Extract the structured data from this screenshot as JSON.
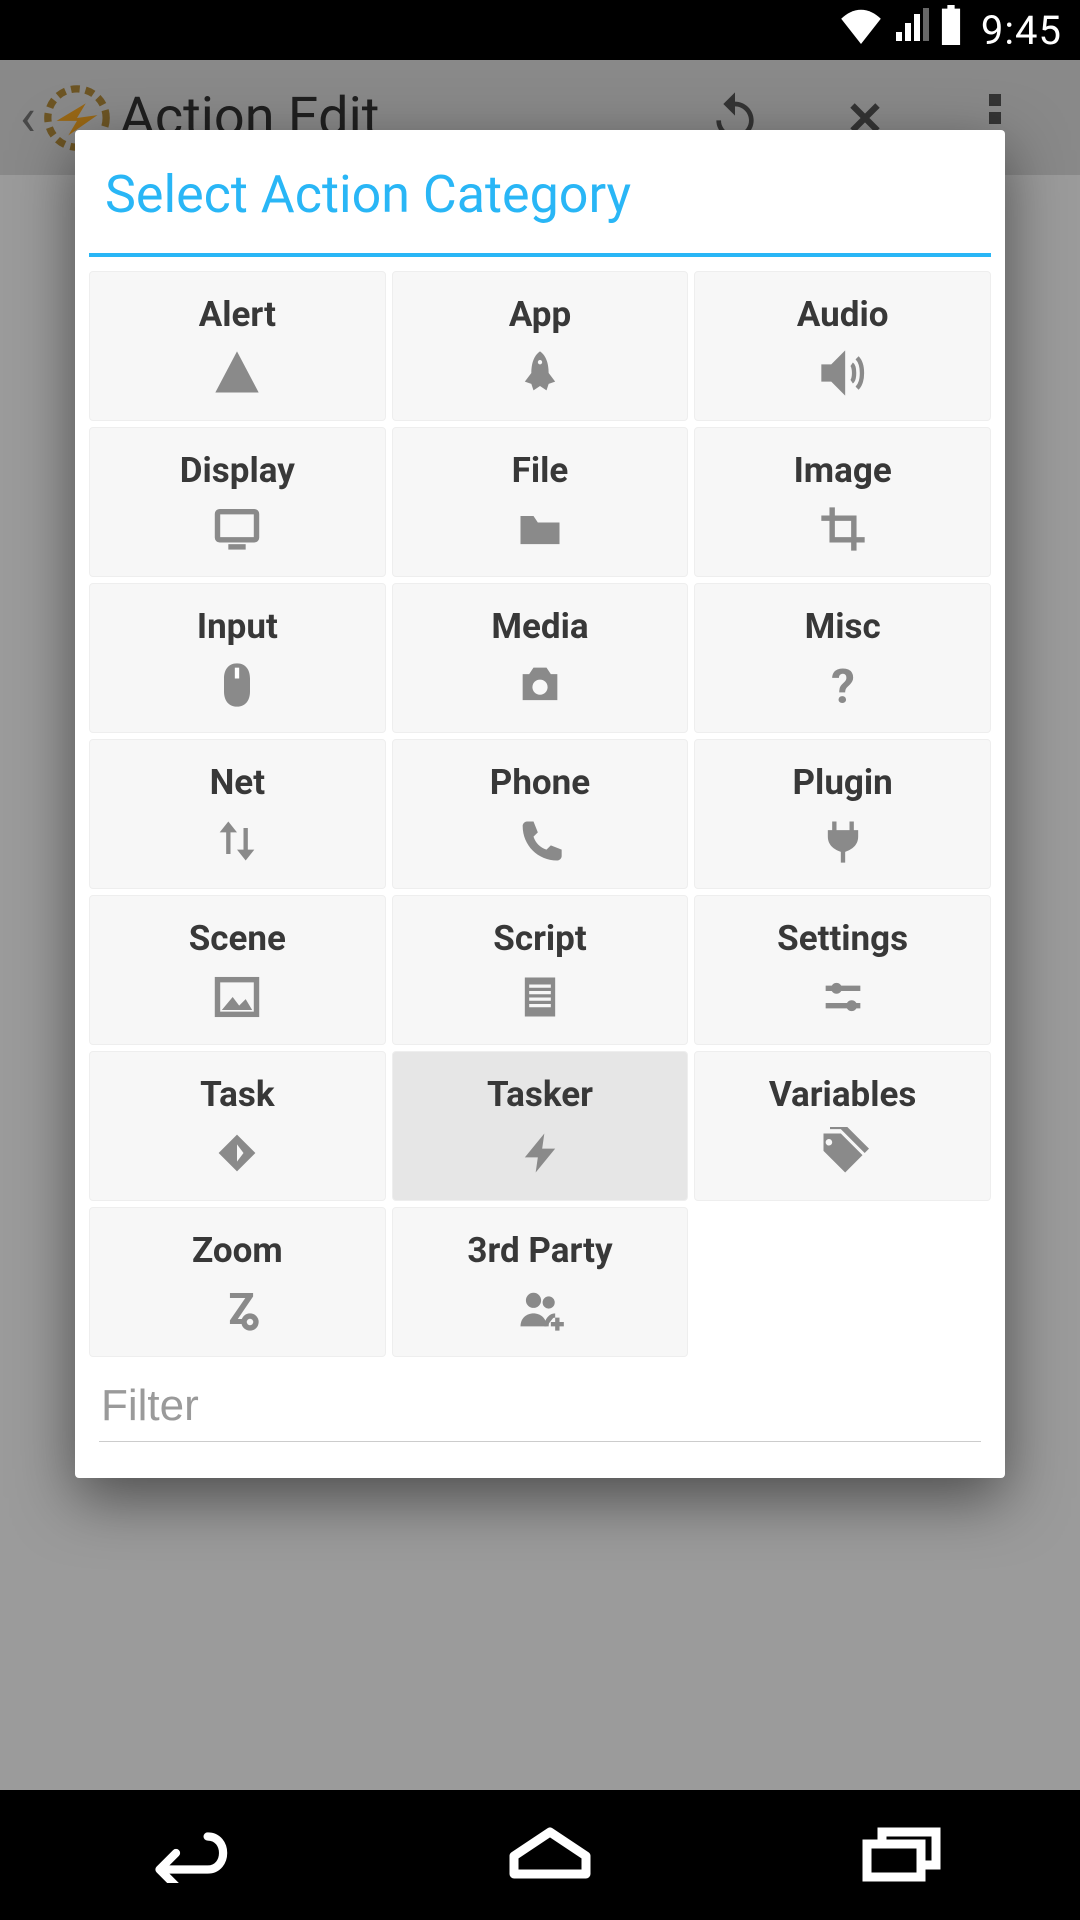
{
  "status": {
    "time": "9:45"
  },
  "appbar": {
    "title": "Action Edit"
  },
  "dialog": {
    "title": "Select Action Category",
    "filter_placeholder": "Filter",
    "categories": [
      {
        "label": "Alert",
        "icon": "alert"
      },
      {
        "label": "App",
        "icon": "rocket"
      },
      {
        "label": "Audio",
        "icon": "speaker"
      },
      {
        "label": "Display",
        "icon": "monitor"
      },
      {
        "label": "File",
        "icon": "folder"
      },
      {
        "label": "Image",
        "icon": "crop"
      },
      {
        "label": "Input",
        "icon": "mouse"
      },
      {
        "label": "Media",
        "icon": "camera"
      },
      {
        "label": "Misc",
        "icon": "question"
      },
      {
        "label": "Net",
        "icon": "updown"
      },
      {
        "label": "Phone",
        "icon": "phone"
      },
      {
        "label": "Plugin",
        "icon": "plug"
      },
      {
        "label": "Scene",
        "icon": "picture"
      },
      {
        "label": "Script",
        "icon": "document"
      },
      {
        "label": "Settings",
        "icon": "sliders"
      },
      {
        "label": "Task",
        "icon": "diamond"
      },
      {
        "label": "Tasker",
        "icon": "bolt",
        "selected": true
      },
      {
        "label": "Variables",
        "icon": "tag"
      },
      {
        "label": "Zoom",
        "icon": "zoom"
      },
      {
        "label": "3rd Party",
        "icon": "group"
      }
    ]
  }
}
